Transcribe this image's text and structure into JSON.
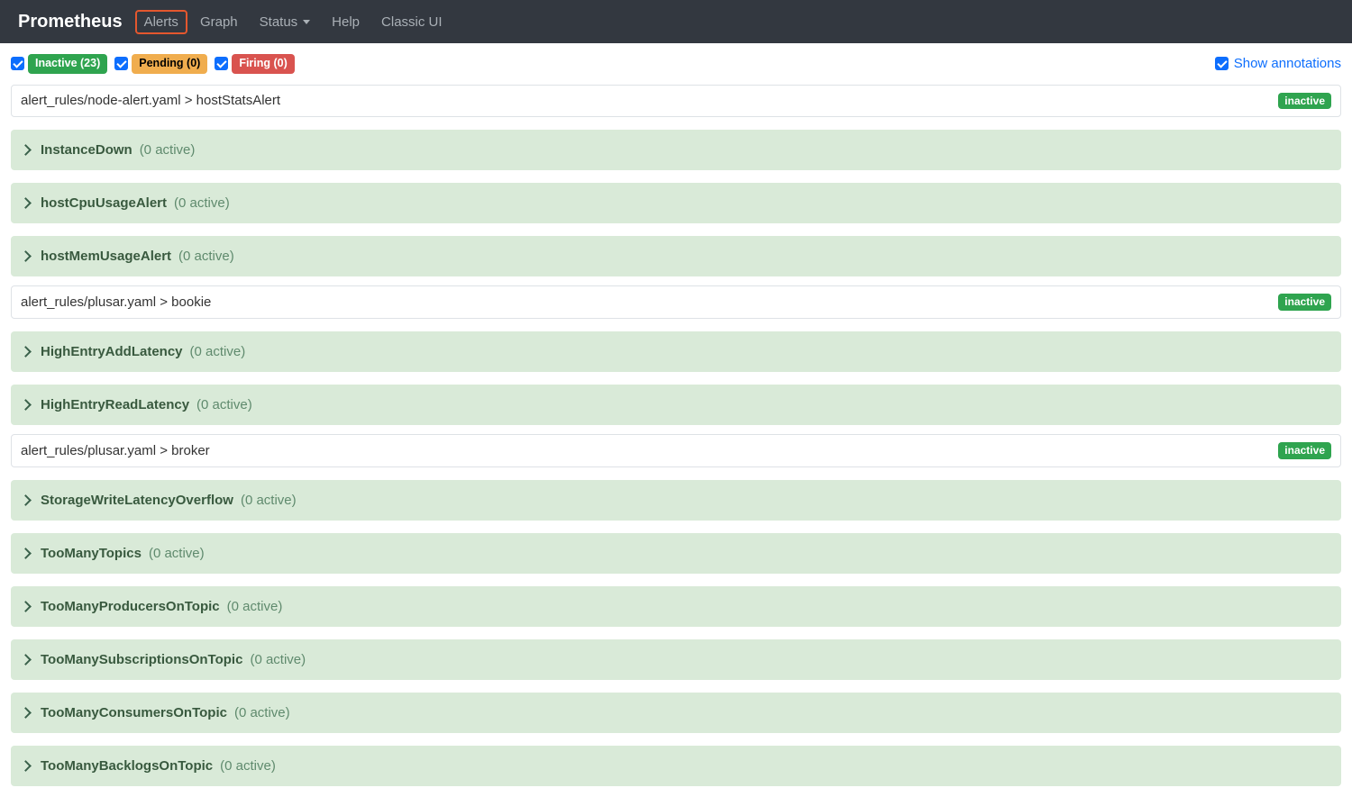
{
  "nav": {
    "brand": "Prometheus",
    "alerts": "Alerts",
    "graph": "Graph",
    "status": "Status",
    "help": "Help",
    "classic": "Classic UI"
  },
  "filters": {
    "inactive": "Inactive (23)",
    "pending": "Pending (0)",
    "firing": "Firing (0)",
    "show_annotations": "Show annotations"
  },
  "status_label": "inactive",
  "groups": [
    {
      "title": "alert_rules/node-alert.yaml > hostStatsAlert",
      "rules": [
        {
          "name": "InstanceDown",
          "count": "(0 active)"
        },
        {
          "name": "hostCpuUsageAlert",
          "count": "(0 active)"
        },
        {
          "name": "hostMemUsageAlert",
          "count": "(0 active)"
        }
      ]
    },
    {
      "title": "alert_rules/plusar.yaml > bookie",
      "rules": [
        {
          "name": "HighEntryAddLatency",
          "count": "(0 active)"
        },
        {
          "name": "HighEntryReadLatency",
          "count": "(0 active)"
        }
      ]
    },
    {
      "title": "alert_rules/plusar.yaml > broker",
      "rules": [
        {
          "name": "StorageWriteLatencyOverflow",
          "count": "(0 active)"
        },
        {
          "name": "TooManyTopics",
          "count": "(0 active)"
        },
        {
          "name": "TooManyProducersOnTopic",
          "count": "(0 active)"
        },
        {
          "name": "TooManySubscriptionsOnTopic",
          "count": "(0 active)"
        },
        {
          "name": "TooManyConsumersOnTopic",
          "count": "(0 active)"
        },
        {
          "name": "TooManyBacklogsOnTopic",
          "count": "(0 active)"
        }
      ]
    }
  ]
}
